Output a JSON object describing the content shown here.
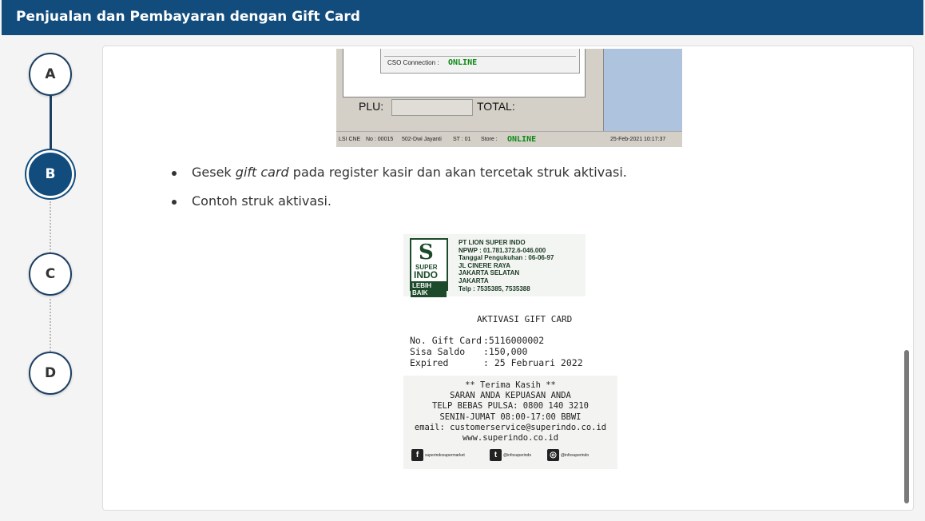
{
  "header": {
    "title": "Penjualan dan Pembayaran dengan Gift Card"
  },
  "steps": [
    {
      "label": "A",
      "active": false
    },
    {
      "label": "B",
      "active": true
    },
    {
      "label": "C",
      "active": false
    },
    {
      "label": "D",
      "active": false
    }
  ],
  "pos": {
    "cso_label": "CSO Connection :",
    "cso_value": "ONLINE",
    "plu_label": "PLU:",
    "total_label": "TOTAL:",
    "status_lsi": "LSI CNE",
    "status_no": "No : 00015",
    "status_cashier": "502-Dwi Jayanti",
    "status_st": "ST : 01",
    "status_store_label": "Store :",
    "status_store_value": "ONLINE",
    "status_datetime": "25-Feb-2021 10:17:37"
  },
  "bullets": {
    "item1_prefix": "Gesek ",
    "item1_em": "gift card",
    "item1_suffix": " pada register kasir dan akan tercetak struk aktivasi.",
    "item2": "Contoh struk aktivasi."
  },
  "receipt": {
    "logo_super": "SUPER",
    "logo_indo": "INDO",
    "logo_lebih": "LEBIH BAIK",
    "company": [
      "PT LION SUPER INDO",
      "NPWP : 01.781.372.6-046.000",
      "Tanggal Pengukuhan : 06-06-97",
      "JL CINERE RAYA",
      "JAKARTA SELATAN",
      "JAKARTA",
      "Telp : 7535385, 7535388"
    ],
    "title": "AKTIVASI GIFT CARD",
    "fields": [
      {
        "key": "No. Gift Card",
        "value": ":5116000002"
      },
      {
        "key": "Sisa Saldo",
        "value": ":150,000"
      },
      {
        "key": "Expired",
        "value": ": 25 Februari 2022"
      }
    ],
    "footer": [
      "** Terima Kasih **",
      "SARAN ANDA KEPUASAN ANDA",
      "TELP BEBAS PULSA: 0800 140 3210",
      "SENIN-JUMAT 08:00-17:00 BBWI",
      "email: customerservice@superindo.co.id",
      "www.superindo.co.id"
    ],
    "social": [
      {
        "icon": "facebook-icon",
        "glyph": "f",
        "text": "superindosupermarket"
      },
      {
        "icon": "twitter-icon",
        "glyph": "t",
        "text": "@infosuperindo"
      },
      {
        "icon": "instagram-icon",
        "glyph": "◎",
        "text": "@infosuperindo"
      }
    ]
  },
  "colors": {
    "header_bg": "#114c7d",
    "online_green": "#0c8a12",
    "step_border": "#1c3f63"
  }
}
